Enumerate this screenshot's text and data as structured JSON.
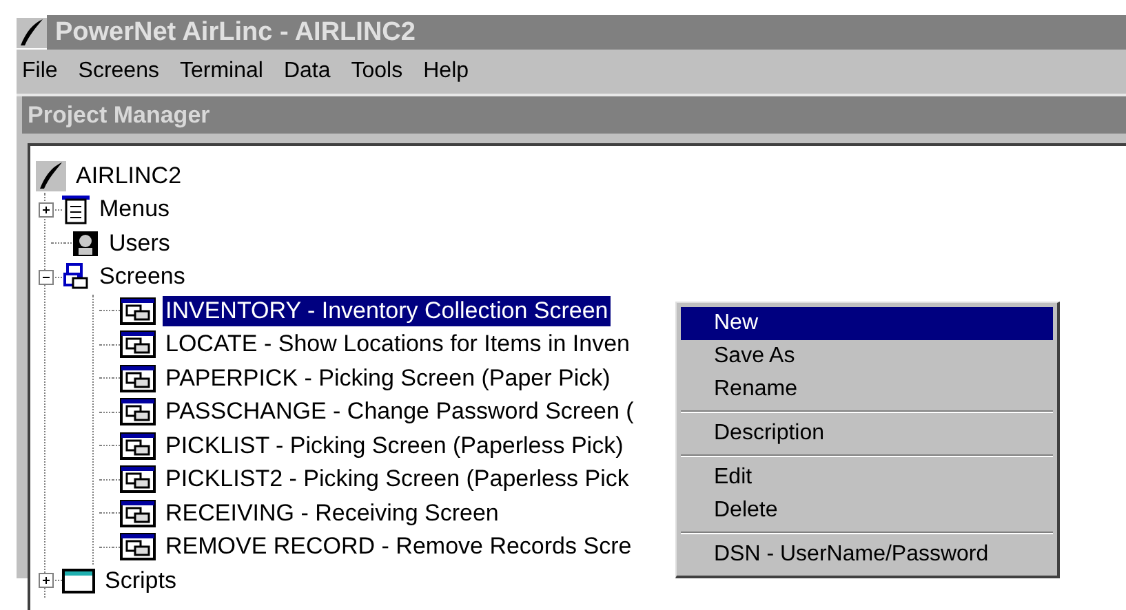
{
  "window": {
    "title": "PowerNet AirLinc - AIRLINC2"
  },
  "menu_bar": [
    "File",
    "Screens",
    "Terminal",
    "Data",
    "Tools",
    "Help"
  ],
  "panel": {
    "title": "Project Manager"
  },
  "tree": {
    "label": "AIRLINC2",
    "kind": "project",
    "selected": false,
    "children": [
      {
        "label": "Menus",
        "kind": "menus",
        "selected": false,
        "expanded": false
      },
      {
        "label": "Users",
        "kind": "users",
        "selected": false
      },
      {
        "label": "Screens",
        "kind": "screens",
        "selected": false,
        "expanded": true,
        "children": [
          {
            "label": "INVENTORY - Inventory Collection Screen",
            "kind": "screen",
            "selected": true
          },
          {
            "label": "LOCATE - Show Locations for Items in Inven",
            "kind": "screen",
            "selected": false
          },
          {
            "label": "PAPERPICK - Picking Screen (Paper Pick)",
            "kind": "screen",
            "selected": false
          },
          {
            "label": "PASSCHANGE - Change Password Screen (",
            "kind": "screen",
            "selected": false
          },
          {
            "label": "PICKLIST - Picking Screen (Paperless Pick)",
            "kind": "screen",
            "selected": false
          },
          {
            "label": "PICKLIST2 - Picking Screen (Paperless Pick",
            "kind": "screen",
            "selected": false
          },
          {
            "label": "RECEIVING - Receiving Screen",
            "kind": "screen",
            "selected": false
          },
          {
            "label": "REMOVE RECORD - Remove Records Scre",
            "kind": "screen",
            "selected": false
          }
        ]
      },
      {
        "label": "Scripts",
        "kind": "scripts",
        "selected": false,
        "expanded": false
      }
    ]
  },
  "context_menu": [
    [
      {
        "label": "New",
        "selected": true
      },
      {
        "label": "Save As",
        "selected": false
      },
      {
        "label": "Rename",
        "selected": false
      }
    ],
    [
      {
        "label": "Description",
        "selected": false
      }
    ],
    [
      {
        "label": "Edit",
        "selected": false
      },
      {
        "label": "Delete",
        "selected": false
      }
    ],
    [
      {
        "label": "DSN - UserName/Password",
        "selected": false
      }
    ]
  ]
}
